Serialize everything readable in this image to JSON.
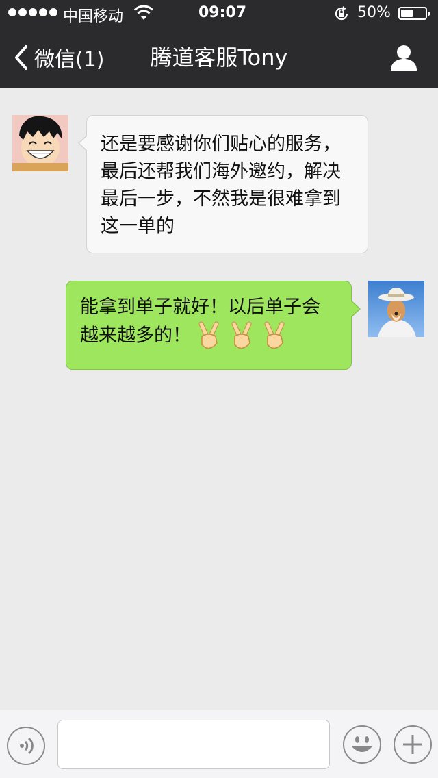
{
  "status_bar": {
    "carrier": "中国移动",
    "time": "09:07",
    "battery": "50%",
    "battery_level": 0.5,
    "icons": [
      "signal-dots-icon",
      "wifi-icon",
      "orientation-lock-icon",
      "battery-icon"
    ]
  },
  "nav": {
    "back_label": "微信(1)",
    "title": "腾道客服Tony",
    "icons": [
      "chevron-left-icon",
      "profile-icon"
    ]
  },
  "messages": [
    {
      "direction": "incoming",
      "text": "还是要感谢你们贴心的服务，最后还帮我们海外邀约，解决最后一步，不然我是很难拿到这一单的",
      "lines": [
        "还是要感谢你们贴心的服务，",
        "最后还帮我们海外邀约，解决",
        "最后一步，不然我是很难拿到",
        "这一单的"
      ]
    },
    {
      "direction": "outgoing",
      "text": "能拿到单子就好！以后单子会越来越多的！✌✌✌",
      "lines": [
        "能拿到单子就好！以后单子会",
        "越来越多的！"
      ],
      "emoji": "victory-hand-icon",
      "emoji_count": 3
    }
  ],
  "input_bar": {
    "value": "",
    "icons": [
      "voice-icon",
      "emoji-face-icon",
      "plus-icon"
    ]
  },
  "colors": {
    "nav_background": "#2b2b2d",
    "chat_background": "#ebebeb",
    "incoming_bubble": "#f8f8f8",
    "outgoing_bubble": "#9ee65e"
  }
}
